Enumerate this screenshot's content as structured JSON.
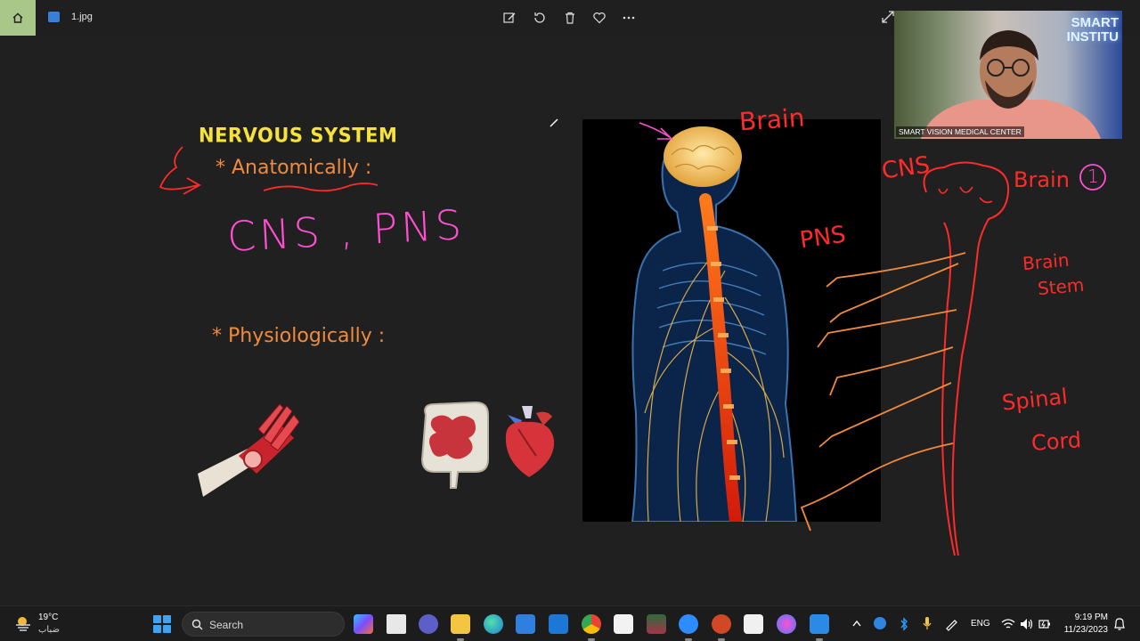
{
  "window": {
    "file_name": "1.jpg"
  },
  "slide": {
    "title": "NERVOUS SYSTEM",
    "anatomically": "* Anatomically :",
    "ink_cns_pns": "CNS , PNS",
    "physiologically": "* Physiologically :"
  },
  "annotations": {
    "brain_top": "Brain",
    "cns": "CNS",
    "brain_right": "Brain",
    "brain_number": "1",
    "pns": "PNS",
    "brain_stem_1": "Brain",
    "brain_stem_2": "Stem",
    "spinal": "Spinal",
    "cord": "Cord"
  },
  "webcam": {
    "label": "SMART VISION MEDICAL CENTER",
    "sign_line1": "SMART",
    "sign_line2": "INSTITU"
  },
  "taskbar": {
    "weather_temp": "19°C",
    "weather_condition": "ضباب",
    "search_label": "Search",
    "language": "ENG",
    "time": "9:19 PM",
    "date": "11/23/2023"
  },
  "colors": {
    "title_yellow": "#f6e23a",
    "heading_orange": "#f08a3c",
    "ink_pink": "#ff4fd0",
    "ink_red": "#ff2a2a",
    "home_green": "#a8c788"
  }
}
